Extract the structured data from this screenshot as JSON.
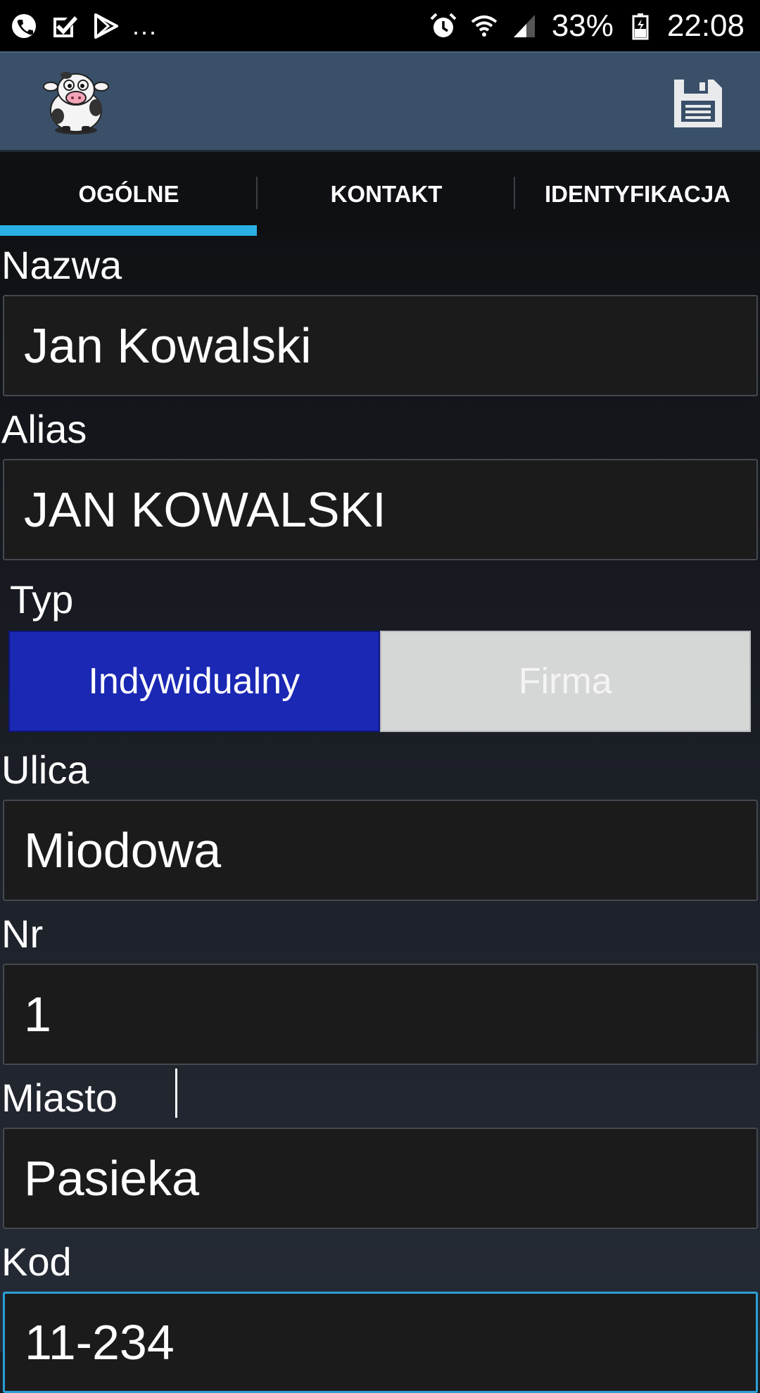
{
  "status_bar": {
    "left_icons": [
      "phone-icon",
      "task-check-icon",
      "play-store-icon"
    ],
    "more": "...",
    "right_icons": [
      "alarm-icon",
      "wifi-icon",
      "signal-icon",
      "battery-icon"
    ],
    "battery": "33%",
    "time": "22:08"
  },
  "app_bar": {
    "logo_icon": "cow-logo-icon",
    "save_icon": "floppy-disk-icon"
  },
  "tabs": [
    {
      "label": "OGÓLNE",
      "active": true
    },
    {
      "label": "KONTAKT",
      "active": false
    },
    {
      "label": "IDENTYFIKACJA",
      "active": false
    }
  ],
  "form": {
    "nazwa": {
      "label": "Nazwa",
      "value": "Jan Kowalski"
    },
    "alias": {
      "label": "Alias",
      "value": "JAN KOWALSKI"
    },
    "typ": {
      "label": "Typ",
      "options": [
        "Indywidualny",
        "Firma"
      ],
      "selected": "Indywidualny"
    },
    "ulica": {
      "label": "Ulica",
      "value": "Miodowa"
    },
    "nr": {
      "label": "Nr",
      "value": "1"
    },
    "miasto": {
      "label": "Miasto",
      "value": "Pasieka"
    },
    "kod": {
      "label": "Kod",
      "value": "11-234"
    }
  },
  "colors": {
    "accent": "#2bb0e3",
    "app_bar": "#3a5069",
    "segment_selected": "#1a28b4",
    "segment_unselected": "#d5d6d6"
  }
}
